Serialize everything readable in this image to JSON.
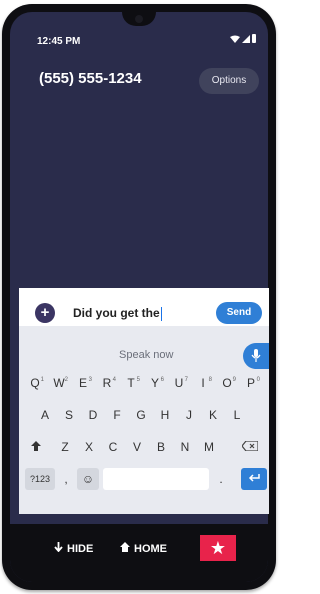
{
  "status_bar": {
    "time": "12:45 PM"
  },
  "header": {
    "phone_number": "(555) 555-1234",
    "options_label": "Options"
  },
  "compose": {
    "add_label": "+",
    "input_value": "Did you get the",
    "send_label": "Send"
  },
  "keyboard": {
    "voice_prompt": "Speak now",
    "row1": [
      {
        "key": "Q",
        "hint": "1"
      },
      {
        "key": "W",
        "hint": "2"
      },
      {
        "key": "E",
        "hint": "3"
      },
      {
        "key": "R",
        "hint": "4"
      },
      {
        "key": "T",
        "hint": "5"
      },
      {
        "key": "Y",
        "hint": "6"
      },
      {
        "key": "U",
        "hint": "7"
      },
      {
        "key": "I",
        "hint": "8"
      },
      {
        "key": "O",
        "hint": "9"
      },
      {
        "key": "P",
        "hint": "0"
      }
    ],
    "row2": [
      "A",
      "S",
      "D",
      "F",
      "G",
      "H",
      "J",
      "K",
      "L"
    ],
    "row3": [
      "Z",
      "X",
      "C",
      "V",
      "B",
      "N",
      "M"
    ],
    "row4": {
      "symbols_label": "?123",
      "comma_label": ",",
      "emoji_label": "☺",
      "period_label": "."
    }
  },
  "bottom_nav": {
    "hide_label": "HIDE",
    "home_label": "HOME"
  },
  "colors": {
    "screen_bg": "#2a2c4b",
    "accent_blue": "#2f7fd6",
    "star_red": "#e8234b"
  },
  "icons": {
    "status": [
      "wifi-icon",
      "signal-icon",
      "battery-icon"
    ],
    "nav": [
      "arrow-down-icon",
      "home-icon",
      "star-icon"
    ],
    "keyboard": [
      "mic-icon",
      "shift-icon",
      "backspace-icon",
      "enter-icon",
      "emoji-icon"
    ]
  }
}
